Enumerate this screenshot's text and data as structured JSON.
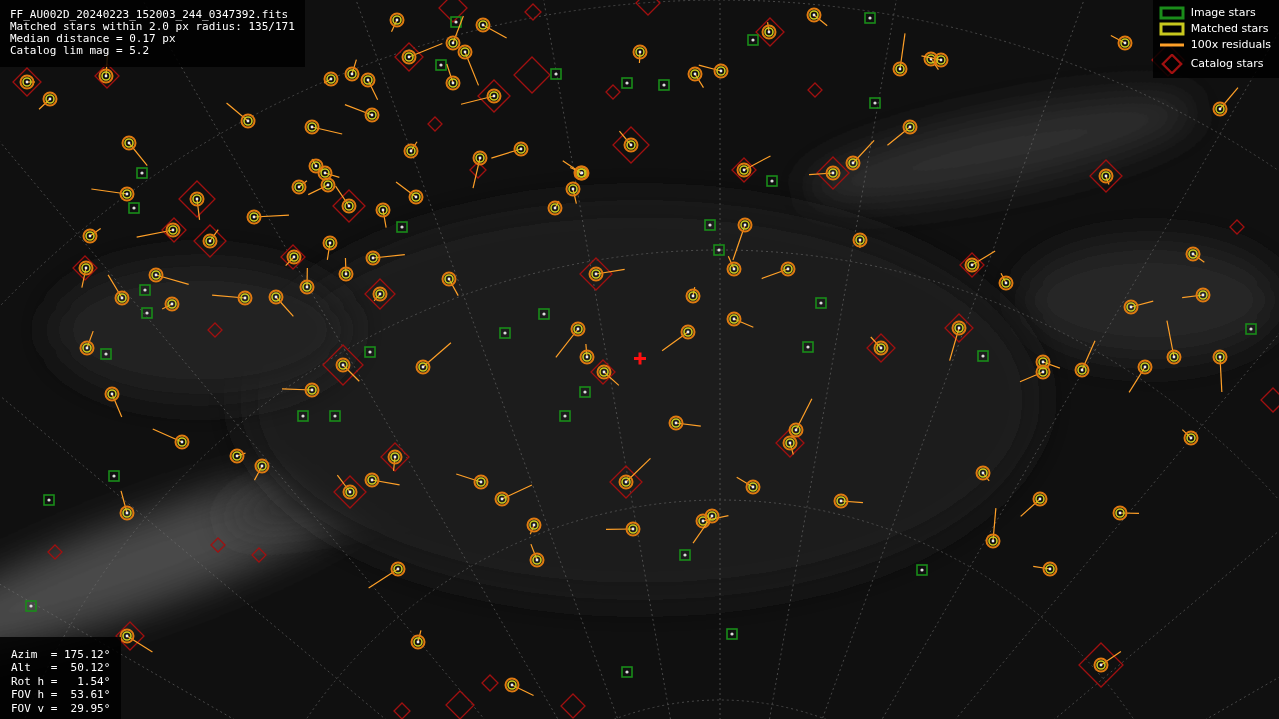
{
  "info_lines": [
    "FF_AU002D_20240223_152003_244_0347392.fits",
    "Matched stars within 2.0 px radius: 135/171",
    "Median distance = 0.17 px",
    "Catalog lim mag = 5.2"
  ],
  "legend": [
    {
      "label": "Image stars",
      "color": "#1a8c1a"
    },
    {
      "kind": "matched",
      "label": "Matched stars",
      "color": "#c8c81e"
    },
    {
      "kind": "residual",
      "label": "100x residuals",
      "color": "#ffa028"
    },
    {
      "kind": "catalog",
      "label": "Catalog stars",
      "color": "#a01010"
    }
  ],
  "pointing_lines": [
    "Azim  = 175.12°",
    "Alt   =  50.12°",
    "Rot h =   1.54°",
    "FOV h =  53.61°",
    "FOV v =  29.95°"
  ]
}
